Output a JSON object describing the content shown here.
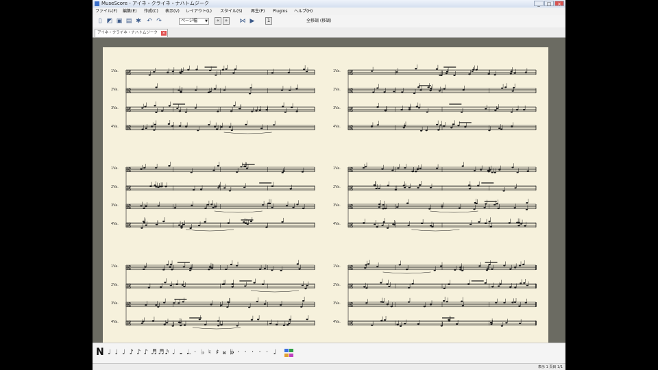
{
  "window": {
    "title": "MuseScore - アイネ・クライネ・ナハトムジーク",
    "minimize": "_",
    "maximize": "□",
    "close": "×"
  },
  "menu": {
    "items": [
      "ファイル(F)",
      "編集(E)",
      "作成(C)",
      "表示(V)",
      "レイアウト(L)",
      "スタイル(S)",
      "再生(P)",
      "Plugins",
      "ヘルプ(H)"
    ]
  },
  "toolbar": {
    "icons": [
      "new-icon",
      "open-icon",
      "save-icon",
      "print-icon",
      "undo-icon",
      "redo-icon"
    ],
    "zoom_value": "ページ幅",
    "concert_pitch": "全移調 (移調)",
    "nav_left": "«",
    "nav_right": "»",
    "page_button": "1"
  },
  "document_tab": {
    "label": "アイネ・クライネ・ナハトムジーク",
    "close": "×"
  },
  "score": {
    "instrument_abbrevs": [
      "1Va.",
      "2Va.",
      "3Va.",
      "4Va."
    ]
  },
  "palette": {
    "note_input_label": "N",
    "glyphs": [
      "♩",
      "♩",
      "♩",
      "♪",
      "♪",
      "♪",
      "♬",
      "♬",
      "𝅘𝅥𝅯",
      "𝅗𝅥",
      "𝅝",
      "𝅘𝅥.",
      "·",
      "♭",
      "♮",
      "♯",
      "𝄪",
      "𝄫",
      "·",
      "·",
      "·",
      "·",
      "·",
      "♩"
    ]
  },
  "status": {
    "text": "表示 1 頁目 1/1"
  },
  "colors": {
    "page": "#f6f1dc",
    "score_bg": "#6b6b62",
    "ink": "#1a1a1a"
  }
}
